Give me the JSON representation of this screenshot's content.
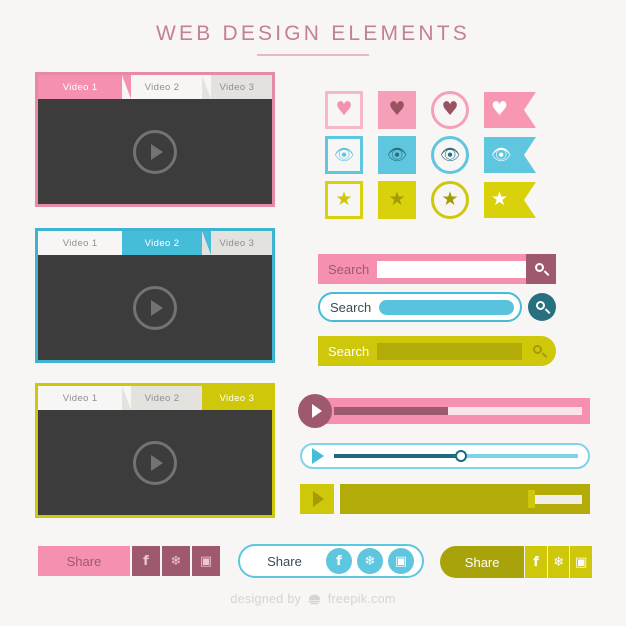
{
  "header": {
    "title": "WEB DESIGN ELEMENTS"
  },
  "colors": {
    "pink": "#f590ae",
    "pink_dark": "#9e5a6c",
    "cyan": "#45bcd8",
    "cyan_dark": "#1b6b7d",
    "olive": "#cfc709",
    "olive_dark": "#b2ab08",
    "screen": "#3c3c3c",
    "background": "#f7f6f4"
  },
  "players": [
    {
      "name": "video-player-pink",
      "accent": "#f590ae",
      "active_index": 0,
      "tabs": [
        "Video 1",
        "Video 2",
        "Video 3"
      ],
      "play_icon": "play-icon"
    },
    {
      "name": "video-player-cyan",
      "accent": "#45bcd8",
      "active_index": 1,
      "tabs": [
        "Video 1",
        "Video 2",
        "Video 3"
      ],
      "play_icon": "play-icon"
    },
    {
      "name": "video-player-olive",
      "accent": "#cfc709",
      "active_index": 2,
      "tabs": [
        "Video 1",
        "Video 2",
        "Video 3"
      ],
      "play_icon": "play-icon"
    }
  ],
  "icon_grid": {
    "rows": [
      {
        "symbol": "heart-icon",
        "color": "#f590ae",
        "glyph": "♥",
        "shapes": [
          "square-outline",
          "square-filled",
          "circle-outline",
          "ribbon-flag"
        ]
      },
      {
        "symbol": "eye-icon",
        "color": "#45bcd8",
        "glyph": "◉",
        "shapes": [
          "square-outline",
          "square-filled",
          "circle-outline",
          "ribbon-flag"
        ]
      },
      {
        "symbol": "star-icon",
        "color": "#cfc709",
        "glyph": "★",
        "shapes": [
          "square-outline",
          "square-filled",
          "circle-outline",
          "ribbon-flag"
        ]
      }
    ]
  },
  "search_bars": [
    {
      "name": "search-bar-pink",
      "label": "Search",
      "placeholder": "",
      "value": "",
      "button_icon": "search-icon",
      "style": "square"
    },
    {
      "name": "search-bar-cyan",
      "label": "Search",
      "placeholder": "",
      "value": "",
      "button_icon": "search-icon",
      "style": "pill"
    },
    {
      "name": "search-bar-olive",
      "label": "Search",
      "placeholder": "",
      "value": "",
      "button_icon": "search-icon",
      "style": "rounded-right"
    }
  ],
  "player_bars": [
    {
      "name": "player-bar-pink",
      "play_icon": "play-icon",
      "progress_percent": 46
    },
    {
      "name": "player-bar-cyan",
      "play_icon": "play-icon",
      "progress_percent": 52
    },
    {
      "name": "player-bar-olive",
      "play_icon": "play-icon",
      "progress_percent": 78
    }
  ],
  "share_bars": [
    {
      "name": "share-bar-pink",
      "label": "Share",
      "socials": [
        "facebook-icon",
        "twitter-icon",
        "instagram-icon"
      ],
      "glyphs": [
        "f",
        "❈",
        "▣"
      ]
    },
    {
      "name": "share-bar-cyan",
      "label": "Share",
      "socials": [
        "facebook-icon",
        "twitter-icon",
        "instagram-icon"
      ],
      "glyphs": [
        "f",
        "❈",
        "▣"
      ]
    },
    {
      "name": "share-bar-olive",
      "label": "Share",
      "socials": [
        "facebook-icon",
        "twitter-icon",
        "instagram-icon"
      ],
      "glyphs": [
        "f",
        "❈",
        "▣"
      ]
    }
  ],
  "footer": {
    "prefix": "designed by",
    "brand": "freepik.com"
  }
}
